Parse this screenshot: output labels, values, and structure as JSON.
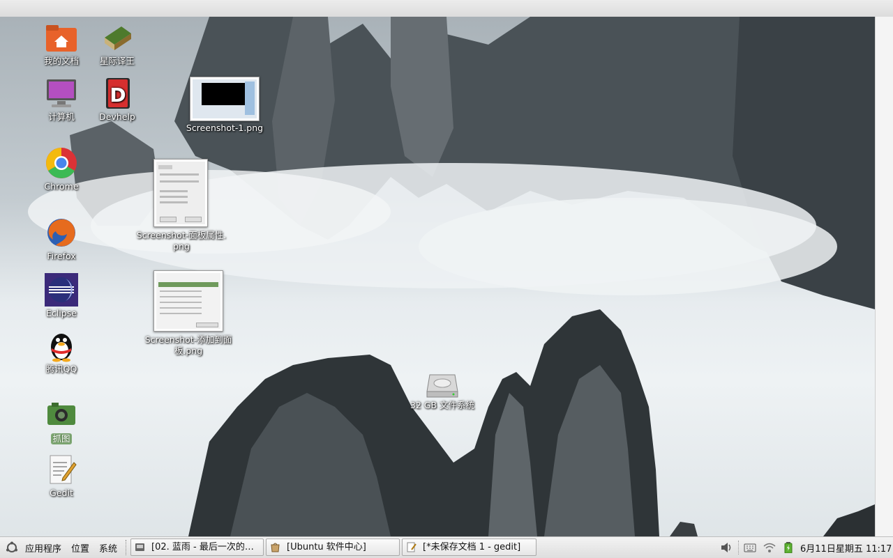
{
  "desktop": {
    "icons": [
      {
        "label": "我的文档",
        "icon": "home-folder-icon"
      },
      {
        "label": "星际译王",
        "icon": "dictionary-book-icon"
      },
      {
        "label": "计算机",
        "icon": "computer-monitor-icon"
      },
      {
        "label": "Devhelp",
        "icon": "devhelp-icon"
      },
      {
        "label": "Chrome",
        "icon": "chrome-icon"
      },
      {
        "label": "Firefox",
        "icon": "firefox-icon"
      },
      {
        "label": "Eclipse",
        "icon": "eclipse-icon"
      },
      {
        "label": "腾讯QQ",
        "icon": "qq-penguin-icon"
      },
      {
        "label": "抓图",
        "icon": "camera-icon"
      },
      {
        "label": "Gedit",
        "icon": "text-editor-icon"
      }
    ],
    "files": [
      {
        "label": "Screenshot-1.png"
      },
      {
        "label_line1": "Screenshot-面板属性.",
        "label_line2": "png"
      },
      {
        "label_line1": "Screenshot-添加到面",
        "label_line2": "板.png"
      }
    ],
    "drive": {
      "label": "32 GB 文件系统",
      "icon": "hard-drive-icon"
    }
  },
  "panel": {
    "menus": [
      "应用程序",
      "位置",
      "系统"
    ],
    "tasks": [
      {
        "label": "[02. 蓝雨 - 最后一次的…",
        "icon": "music-player-icon"
      },
      {
        "label": "[Ubuntu 软件中心]",
        "icon": "software-center-icon"
      },
      {
        "label": "[*未保存文档 1 - gedit]",
        "icon": "gedit-doc-icon"
      }
    ],
    "tray": [
      "volume-icon",
      "keyboard-icon",
      "wifi-icon",
      "battery-icon"
    ],
    "clock": "6月11日星期五 11:17"
  },
  "colors": {
    "selected_label_bg": "#7fa874",
    "panel_bg": "#e6e6e6"
  }
}
